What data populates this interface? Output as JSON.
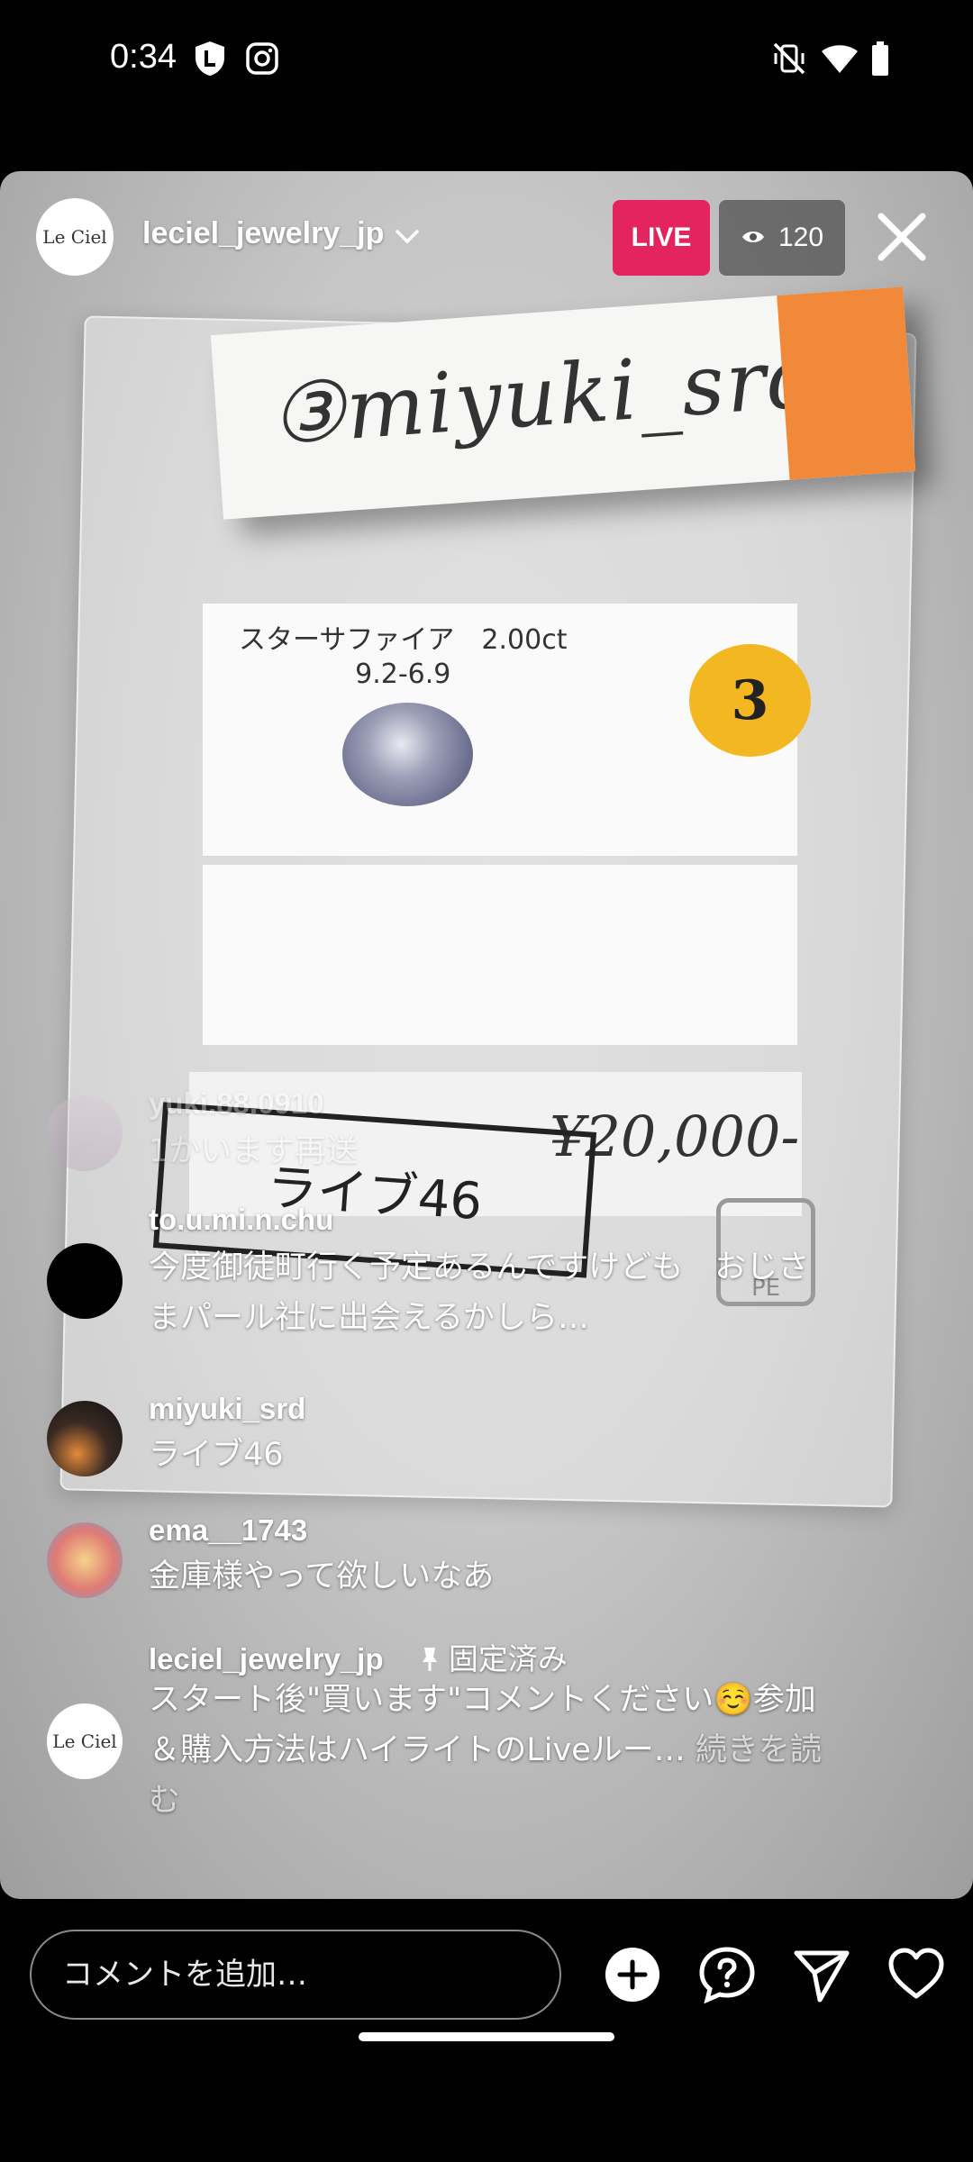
{
  "status_bar": {
    "time": "0:34",
    "icons": [
      "shield-l-icon",
      "instagram-icon",
      "vibrate-off-icon",
      "wifi-icon",
      "battery-icon"
    ]
  },
  "live": {
    "host": "leciel_jewelry_jp",
    "host_avatar_text": "Le Ciel",
    "badge": "LIVE",
    "viewer_count": "120"
  },
  "video_content": {
    "tag_handwriting": "③miyuki_srd",
    "card_printed_line1": "スターサファイア　2.00ct",
    "card_printed_line2": "9.2-6.9",
    "sticker_number": "3",
    "price_handwriting": "¥20,000-",
    "label": "ライブ46",
    "pe_mark": "PE"
  },
  "comments": [
    {
      "user": "yuki.88.0910",
      "text": "1かいます再送"
    },
    {
      "user": "to.u.mi.n.chu",
      "text": "今度御徒町行く予定あるんですけども　おじさまパール社に出会えるかしら…"
    },
    {
      "user": "miyuki_srd",
      "text": "ライブ46"
    },
    {
      "user": "ema__1743",
      "text": "金庫様やって欲しいなあ"
    },
    {
      "user": "leciel_jewelry_jp",
      "pinned_label": "固定済み",
      "avatar_text": "Le Ciel",
      "text": "スタート後\"買います\"コメントください☺️参加＆購入方法はハイライトのLiveルー…",
      "more": "続きを読む"
    }
  ],
  "bottom_bar": {
    "comment_placeholder": "コメントを追加…",
    "icons": [
      "add-circle-icon",
      "question-bubble-icon",
      "send-icon",
      "heart-icon"
    ]
  }
}
